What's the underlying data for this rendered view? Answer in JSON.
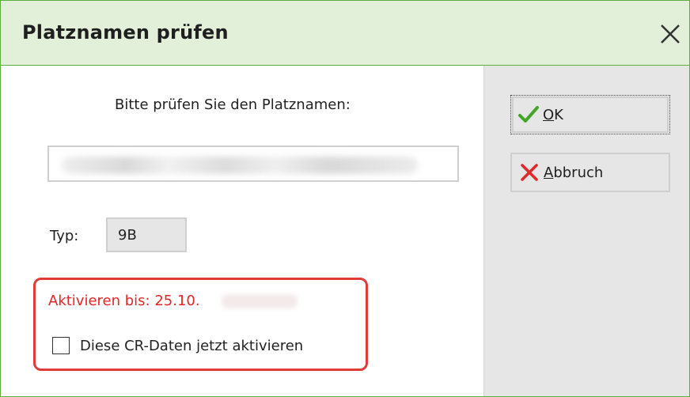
{
  "dialog": {
    "title": "Platznamen prüfen"
  },
  "form": {
    "prompt": "Bitte prüfen Sie den Platznamen:",
    "name_value": "",
    "type_label": "Typ:",
    "type_value": "9B",
    "activate_text": "Aktivieren bis: 25.10.",
    "checkbox_label": "Diese CR-Daten jetzt aktivieren",
    "checkbox_checked": false
  },
  "buttons": {
    "ok": {
      "accel": "O",
      "rest": "K"
    },
    "cancel": {
      "accel": "A",
      "rest": "bbruch"
    }
  },
  "icons": {
    "ok": "checkmark-icon",
    "cancel": "x-icon",
    "close": "close-icon"
  },
  "colors": {
    "title_bar": "#e2f0d9",
    "border": "#5fae3f",
    "highlight": "#e33a3a",
    "ok_icon": "#43a628",
    "cancel_icon": "#e02b2b"
  }
}
